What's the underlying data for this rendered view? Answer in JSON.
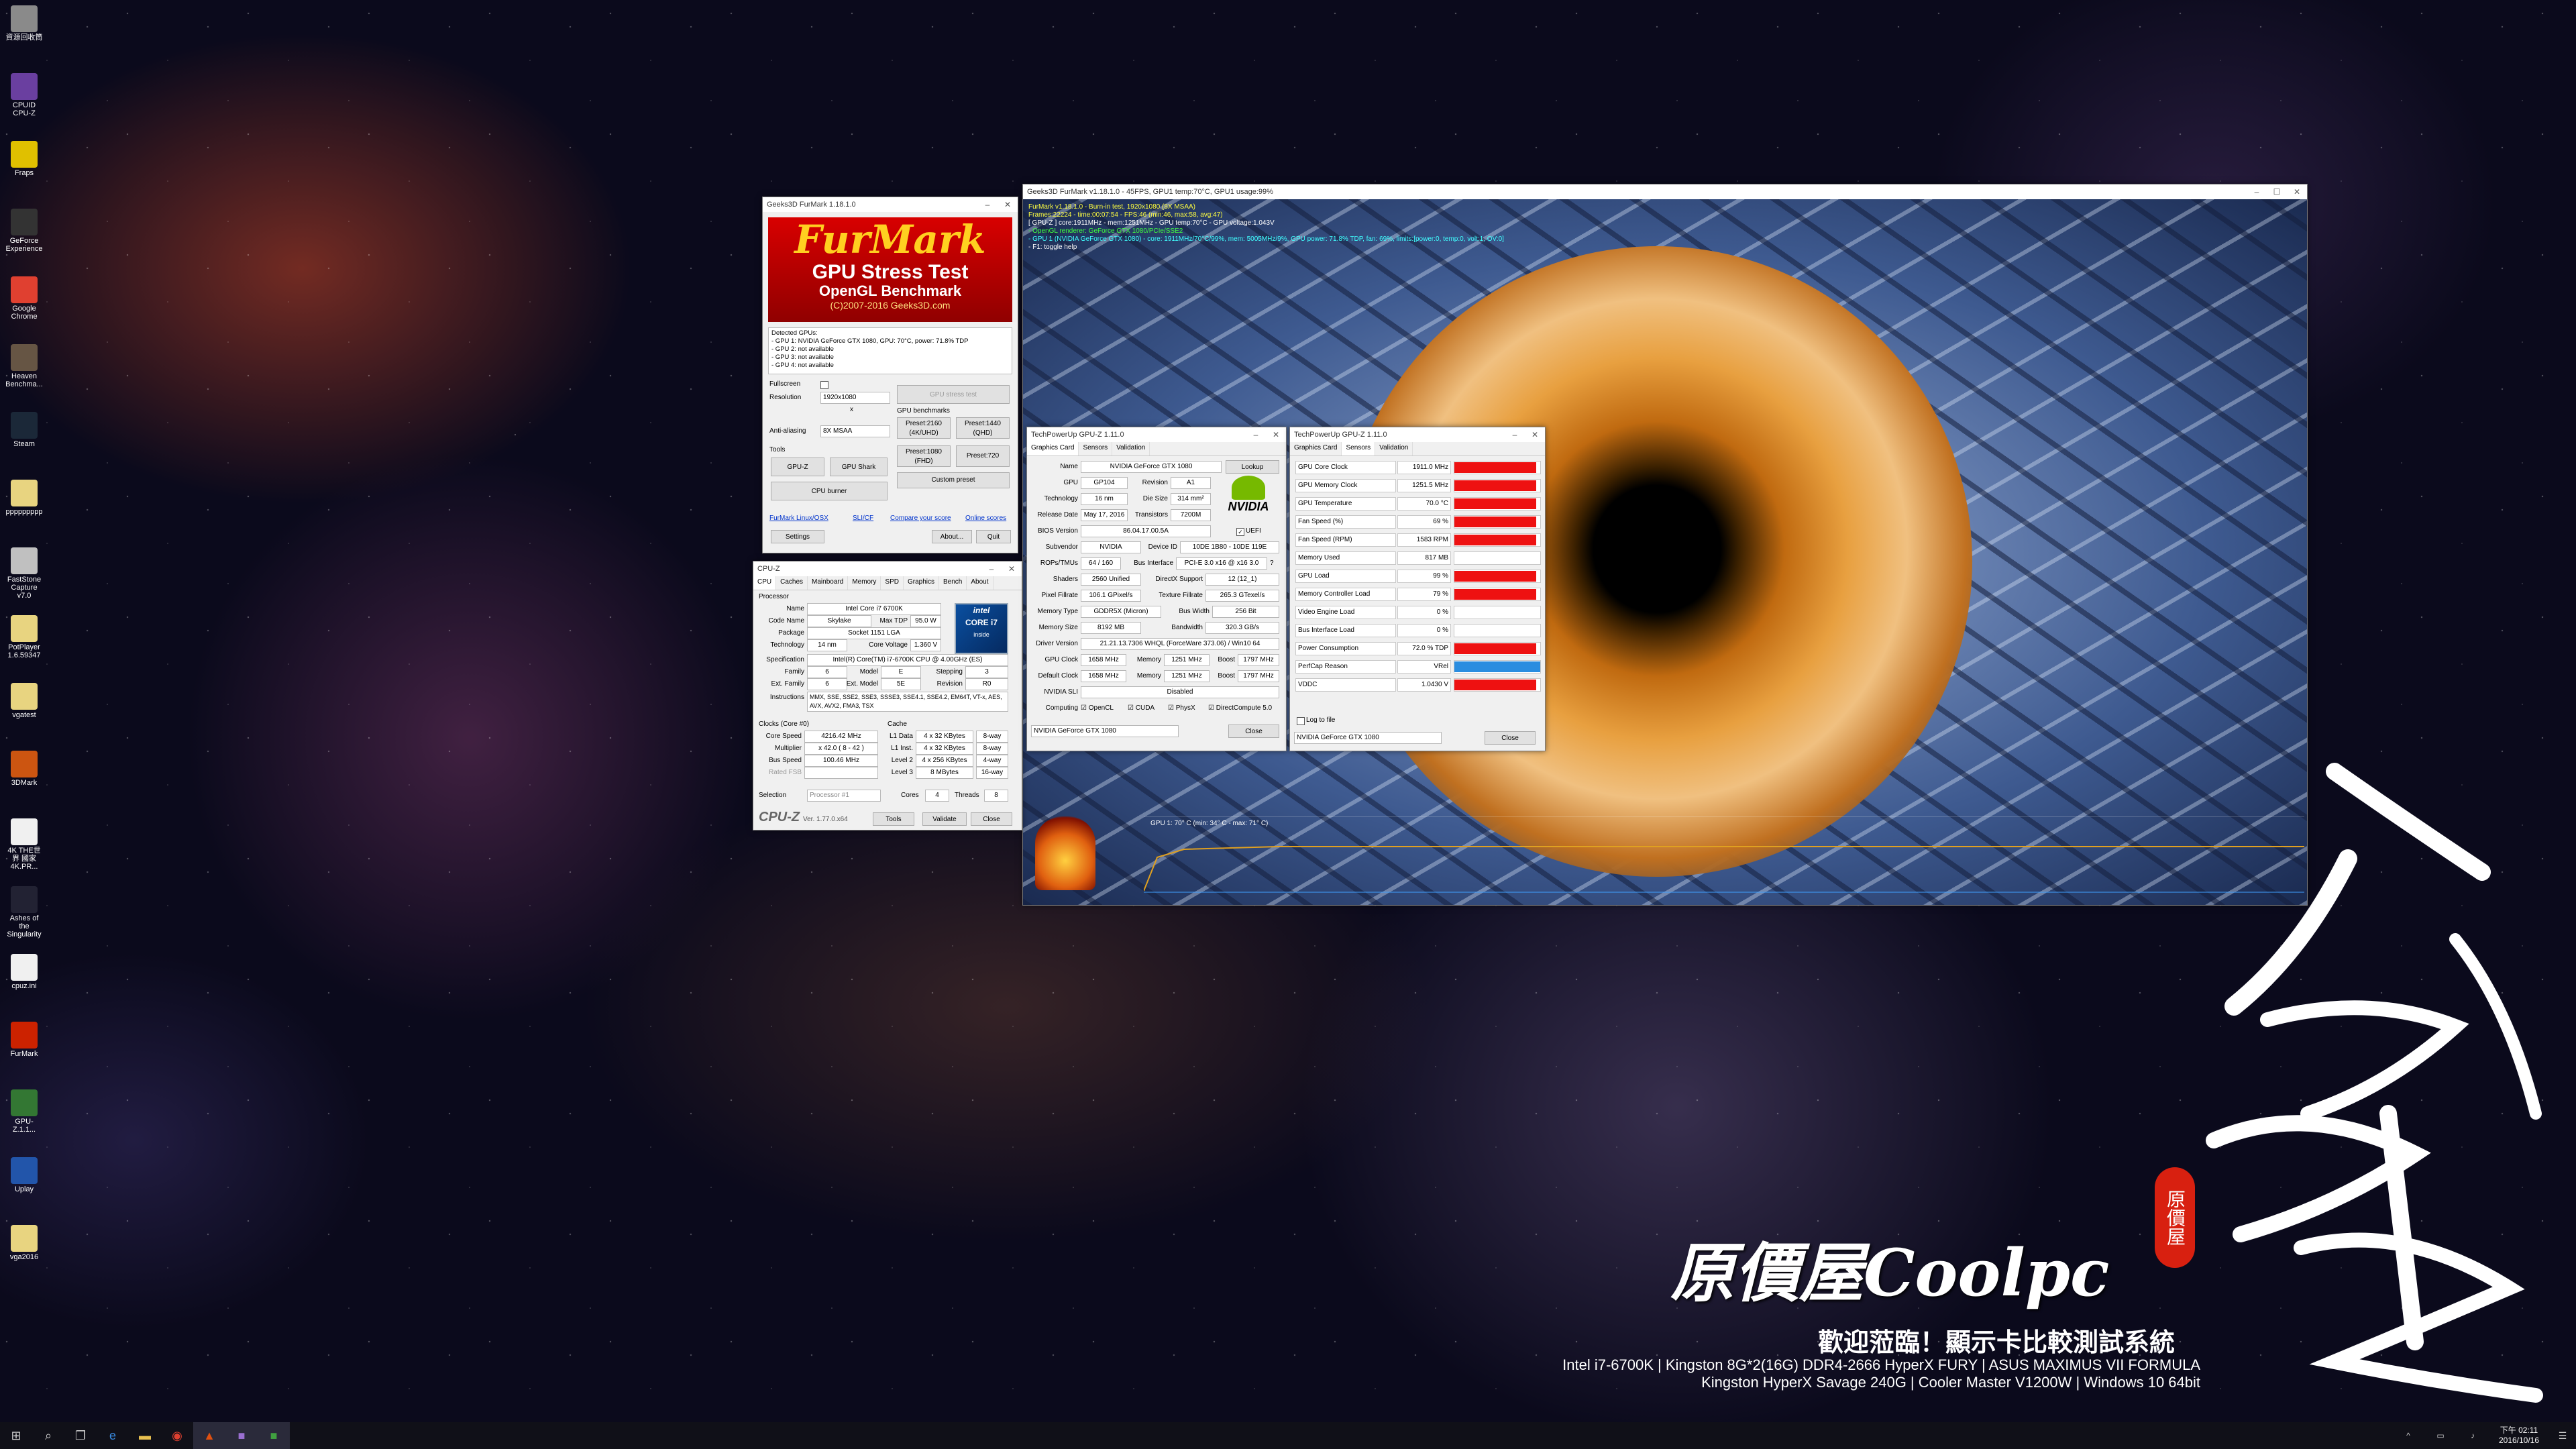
{
  "desktop_icons": [
    {
      "label": "資源回收筒",
      "color": "#8a8a8a"
    },
    {
      "label": "CPUID CPU-Z",
      "color": "#6a3fa0"
    },
    {
      "label": "Fraps",
      "color": "#e0c000"
    },
    {
      "label": "GeForce Experience",
      "color": "#333333"
    },
    {
      "label": "Google Chrome",
      "color": "#e04030"
    },
    {
      "label": "Heaven Benchma...",
      "color": "#665544"
    },
    {
      "label": "Steam",
      "color": "#1b2838"
    },
    {
      "label": "ppppppppp",
      "color": "#e8d480"
    },
    {
      "label": "FastStone Capture v7.0",
      "color": "#c0c0c0"
    },
    {
      "label": "PotPlayer 1.6.59347",
      "color": "#e8d480"
    },
    {
      "label": "vgatest",
      "color": "#e8d480"
    },
    {
      "label": "3DMark",
      "color": "#cc5511"
    },
    {
      "label": "4K THE世界 國家4K.PR...",
      "color": "#f0f0f0"
    },
    {
      "label": "Ashes of the Singularity",
      "color": "#222233"
    },
    {
      "label": "cpuz.ini",
      "color": "#f0f0f0"
    },
    {
      "label": "FurMark",
      "color": "#cc2200"
    },
    {
      "label": "GPU-Z.1.1...",
      "color": "#337733"
    },
    {
      "label": "Uplay",
      "color": "#2255aa"
    },
    {
      "label": "vga2016",
      "color": "#e8d480"
    }
  ],
  "furmark_launcher": {
    "title": "Geeks3D FurMark 1.18.1.0",
    "logo_title": "FurMark",
    "logo_sub": "GPU Stress Test",
    "logo_sub2": "OpenGL Benchmark",
    "logo_copy": "(C)2007-2016 Geeks3D.com",
    "detected_header": "Detected GPUs:",
    "gpus": [
      "- GPU 1: NVIDIA GeForce GTX 1080, GPU: 70°C, power: 71.8% TDP",
      "- GPU 2: not available",
      "- GPU 3: not available",
      "- GPU 4: not available"
    ],
    "fullscreen_label": "Fullscreen",
    "resolution_label": "Resolution",
    "resolution_value": "1920x1080",
    "x_label": "x",
    "aa_label": "Anti-aliasing",
    "aa_value": "8X MSAA",
    "stress_btn": "GPU stress test",
    "bench_label": "GPU benchmarks",
    "preset_2160": "Preset:2160 (4K/UHD)",
    "preset_1440": "Preset:1440 (QHD)",
    "preset_1080": "Preset:1080 (FHD)",
    "preset_720": "Preset:720",
    "custom_preset": "Custom preset",
    "tools_label": "Tools",
    "gpuz_btn": "GPU-Z",
    "gpushark_btn": "GPU Shark",
    "cpuburner_btn": "CPU burner",
    "link1": "FurMark Linux/OSX",
    "link2": "SLI/CF",
    "link3": "Compare your score",
    "link4": "Online scores",
    "settings_btn": "Settings",
    "about_btn": "About...",
    "quit_btn": "Quit"
  },
  "furmark_render": {
    "title": "Geeks3D FurMark v1.18.1.0 - 45FPS, GPU1 temp:70°C, GPU1 usage:99%",
    "overlay": [
      "FurMark v1.18.1.0 - Burn-in test, 1920x1080 (8X MSAA)",
      "Frames:22224 - time:00:07:54 - FPS:46 (min:46, max:58, avg:47)",
      "[ GPU-Z ] core:1911MHz - mem:1251MHz - GPU temp:70°C - GPU voltage:1.043V",
      "- OpenGL renderer: GeForce GTX 1080/PCIe/SSE2",
      "- GPU 1 (NVIDIA GeForce GTX 1080) - core: 1911MHz/70°C/99%, mem: 5005MHz/9%, GPU power: 71.8% TDP, fan: 69%, limits:[power:0, temp:0, volt:1, OV:0]",
      "- F1: toggle help"
    ],
    "graph_label": "GPU 1: 70° C (min: 34° C - max: 71° C)"
  },
  "gpuz_card": {
    "title": "TechPowerUp GPU-Z 1.11.0",
    "tabs": [
      "Graphics Card",
      "Sensors",
      "Validation"
    ],
    "name_label": "Name",
    "name": "NVIDIA GeForce GTX 1080",
    "lookup_btn": "Lookup",
    "gpu_label": "GPU",
    "gpu": "GP104",
    "revision_label": "Revision",
    "revision": "A1",
    "tech_label": "Technology",
    "tech": "16 nm",
    "die_label": "Die Size",
    "die": "314 mm²",
    "release_label": "Release Date",
    "release": "May 17, 2016",
    "transistors_label": "Transistors",
    "transistors": "7200M",
    "bios_label": "BIOS Version",
    "bios": "86.04.17.00.5A",
    "uefi_label": "UEFI",
    "subvendor_label": "Subvendor",
    "subvendor": "NVIDIA",
    "device_label": "Device ID",
    "device": "10DE 1B80 - 10DE 119E",
    "rops_label": "ROPs/TMUs",
    "rops": "64 / 160",
    "bus_label": "Bus Interface",
    "bus": "PCI-E 3.0 x16 @ x16 3.0",
    "shaders_label": "Shaders",
    "shaders": "2560 Unified",
    "dx_label": "DirectX Support",
    "dx": "12 (12_1)",
    "pixel_label": "Pixel Fillrate",
    "pixel": "106.1 GPixel/s",
    "texture_label": "Texture Fillrate",
    "texture": "265.3 GTexel/s",
    "memtype_label": "Memory Type",
    "memtype": "GDDR5X (Micron)",
    "buswidth_label": "Bus Width",
    "buswidth": "256 Bit",
    "memsize_label": "Memory Size",
    "memsize": "8192 MB",
    "bandwidth_label": "Bandwidth",
    "bandwidth": "320.3 GB/s",
    "driver_label": "Driver Version",
    "driver": "21.21.13.7306 WHQL (ForceWare 373.06) / Win10 64",
    "gpuclock_label": "GPU Clock",
    "gpuclock": "1658 MHz",
    "mem_label": "Memory",
    "memclock": "1251 MHz",
    "boost_label": "Boost",
    "boost": "1797 MHz",
    "defclock_label": "Default Clock",
    "defclock": "1658 MHz",
    "defmem": "1251 MHz",
    "defboost": "1797 MHz",
    "sli_label": "NVIDIA SLI",
    "sli": "Disabled",
    "computing_label": "Computing",
    "compute": [
      "OpenCL",
      "CUDA",
      "PhysX",
      "DirectCompute 5.0"
    ],
    "select": "NVIDIA GeForce GTX 1080",
    "close_btn": "Close",
    "logo": "NVIDIA"
  },
  "gpuz_sensors": {
    "title": "TechPowerUp GPU-Z 1.11.0",
    "tabs": [
      "Graphics Card",
      "Sensors",
      "Validation"
    ],
    "rows": [
      {
        "name": "GPU Core Clock",
        "value": "1911.0 MHz",
        "level": 0.95,
        "color": "#ee1111"
      },
      {
        "name": "GPU Memory Clock",
        "value": "1251.5 MHz",
        "level": 0.95,
        "color": "#ee1111"
      },
      {
        "name": "GPU Temperature",
        "value": "70.0 °C",
        "level": 0.95,
        "color": "#ee1111"
      },
      {
        "name": "Fan Speed (%)",
        "value": "69 %",
        "level": 0.95,
        "color": "#ee1111"
      },
      {
        "name": "Fan Speed (RPM)",
        "value": "1583 RPM",
        "level": 0.95,
        "color": "#ee1111"
      },
      {
        "name": "Memory Used",
        "value": "817 MB",
        "level": 0.0,
        "color": "#ee1111"
      },
      {
        "name": "GPU Load",
        "value": "99 %",
        "level": 0.95,
        "color": "#ee1111"
      },
      {
        "name": "Memory Controller Load",
        "value": "79 %",
        "level": 0.95,
        "color": "#ee1111"
      },
      {
        "name": "Video Engine Load",
        "value": "0 %",
        "level": 0.0,
        "color": "#ee1111"
      },
      {
        "name": "Bus Interface Load",
        "value": "0 %",
        "level": 0.0,
        "color": "#ee1111"
      },
      {
        "name": "Power Consumption",
        "value": "72.0 % TDP",
        "level": 0.95,
        "color": "#ee1111"
      },
      {
        "name": "PerfCap Reason",
        "value": "VRel",
        "level": 1.0,
        "color": "#2a8de0"
      },
      {
        "name": "VDDC",
        "value": "1.0430 V",
        "level": 0.95,
        "color": "#ee1111"
      }
    ],
    "log_label": "Log to file",
    "select": "NVIDIA GeForce GTX 1080",
    "close_btn": "Close"
  },
  "cpuz": {
    "title": "CPU-Z",
    "tabs": [
      "CPU",
      "Caches",
      "Mainboard",
      "Memory",
      "SPD",
      "Graphics",
      "Bench",
      "About"
    ],
    "processor_label": "Processor",
    "name_label": "Name",
    "name": "Intel Core i7 6700K",
    "codename_label": "Code Name",
    "codename": "Skylake",
    "maxtdp_label": "Max TDP",
    "maxtdp": "95.0 W",
    "package_label": "Package",
    "package": "Socket 1151 LGA",
    "technology_label": "Technology",
    "technology": "14 nm",
    "corevolt_label": "Core Voltage",
    "corevolt": "1.360 V",
    "spec_label": "Specification",
    "spec": "Intel(R) Core(TM) i7-6700K CPU @ 4.00GHz (ES)",
    "family_label": "Family",
    "family": "6",
    "model_label": "Model",
    "model": "E",
    "stepping_label": "Stepping",
    "stepping": "3",
    "extfamily_label": "Ext. Family",
    "extfamily": "6",
    "extmodel_label": "Ext. Model",
    "extmodel": "5E",
    "revision_label": "Revision",
    "revision": "R0",
    "instr_label": "Instructions",
    "instr": "MMX, SSE, SSE2, SSE3, SSSE3, SSE4.1, SSE4.2, EM64T, VT-x, AES, AVX, AVX2, FMA3, TSX",
    "clocks_label": "Clocks (Core #0)",
    "cache_label": "Cache",
    "corespeed_label": "Core Speed",
    "corespeed": "4216.42 MHz",
    "multiplier_label": "Multiplier",
    "multiplier": "x 42.0 ( 8 - 42 )",
    "busspeed_label": "Bus Speed",
    "busspeed": "100.46 MHz",
    "ratedfsb_label": "Rated FSB",
    "l1d_label": "L1 Data",
    "l1d": "4 x 32 KBytes",
    "l1d_way": "8-way",
    "l1i_label": "L1 Inst.",
    "l1i": "4 x 32 KBytes",
    "l1i_way": "8-way",
    "l2_label": "Level 2",
    "l2": "4 x 256 KBytes",
    "l2_way": "4-way",
    "l3_label": "Level 3",
    "l3": "8 MBytes",
    "l3_way": "16-way",
    "selection_label": "Selection",
    "selection": "Processor #1",
    "cores_label": "Cores",
    "cores": "4",
    "threads_label": "Threads",
    "threads": "8",
    "brand": "CPU-Z",
    "version": "Ver. 1.77.0.x64",
    "tools_btn": "Tools",
    "validate_btn": "Validate",
    "close_btn": "Close",
    "intel_logo_1": "intel",
    "intel_logo_2": "CORE i7",
    "intel_logo_3": "inside"
  },
  "branding": {
    "coolpc": "原價屋Coolpc",
    "welcome": "歡迎蒞臨！顯示卡比較測試系統",
    "spec1": "Intel i7-6700K | Kingston 8G*2(16G) DDR4-2666 HyperX FURY | ASUS MAXIMUS VII FORMULA",
    "spec2": "Kingston HyperX Savage 240G | Cooler Master V1200W | Windows 10 64bit",
    "seal": "原價屋",
    "callig": "館"
  },
  "taskbar": {
    "time": "下午 02:11",
    "date": "2016/10/16"
  }
}
